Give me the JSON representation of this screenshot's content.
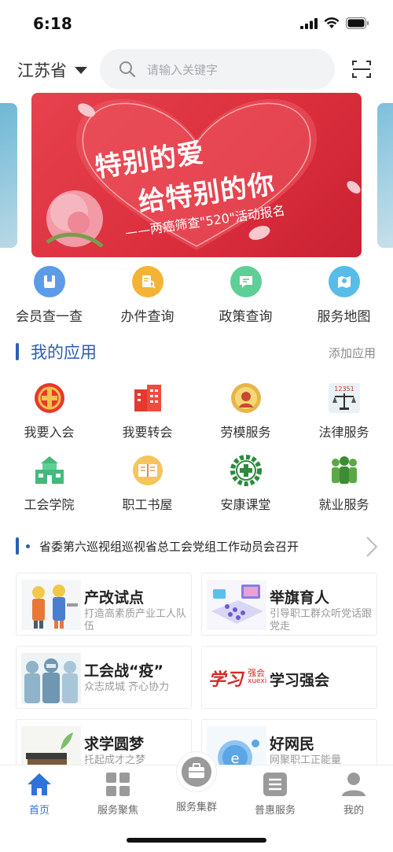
{
  "status_bar": {
    "time": "6:18"
  },
  "header": {
    "province": "江苏省",
    "search_placeholder": "请输入关键字"
  },
  "banner": {
    "line1": "特别的爱",
    "line2": "给特别的你",
    "line3": "——两癌筛查\"520\"活动报名"
  },
  "quick_services": [
    {
      "label": "会员查一查",
      "icon": "member-card-icon",
      "color": "#4a90e2"
    },
    {
      "label": "办件查询",
      "icon": "document-search-icon",
      "color": "#f5a623"
    },
    {
      "label": "政策查询",
      "icon": "policy-chat-icon",
      "color": "#4cc38a"
    },
    {
      "label": "服务地图",
      "icon": "map-icon",
      "color": "#4ab3e6"
    }
  ],
  "my_apps": {
    "title": "我的应用",
    "add_label": "添加应用",
    "items": [
      {
        "label": "我要入会",
        "icon": "union-emblem-icon"
      },
      {
        "label": "我要转会",
        "icon": "building-icon"
      },
      {
        "label": "劳模服务",
        "icon": "model-worker-medal-icon"
      },
      {
        "label": "法律服务",
        "icon": "legal-scale-icon",
        "badge": "12351"
      },
      {
        "label": "工会学院",
        "icon": "school-icon"
      },
      {
        "label": "职工书屋",
        "icon": "book-icon"
      },
      {
        "label": "安康课堂",
        "icon": "health-cross-gear-icon"
      },
      {
        "label": "就业服务",
        "icon": "people-group-icon"
      }
    ]
  },
  "news_ticker": {
    "text": "省委第六巡视组巡视省总工会党组工作动员会召开"
  },
  "cards": [
    {
      "title": "产改试点",
      "subtitle": "打造高素质产业工人队伍",
      "icon": "workers-illustration-icon"
    },
    {
      "title": "举旗育人",
      "subtitle": "引导职工群众听党话跟党走",
      "icon": "classroom-illustration-icon"
    },
    {
      "title": "工会战“疫”",
      "subtitle": "众志成城  齐心协力",
      "icon": "medical-staff-illustration-icon"
    },
    {
      "title": "学习强会",
      "subtitle": "",
      "brand": "学习",
      "brand_tag": "强会",
      "brand_sub": "xuexi",
      "icon": "xuexi-logo-icon"
    },
    {
      "title": "求学圆梦",
      "subtitle": "托起成才之梦",
      "icon": "books-illustration-icon"
    },
    {
      "title": "好网民",
      "subtitle": "网聚职工正能量",
      "icon": "globe-illustration-icon"
    }
  ],
  "tab_bar": [
    {
      "label": "首页",
      "icon": "home-icon",
      "active": true
    },
    {
      "label": "服务聚焦",
      "icon": "grid-icon",
      "active": false
    },
    {
      "label": "服务集群",
      "icon": "briefcase-icon",
      "active": false
    },
    {
      "label": "普惠服务",
      "icon": "list-icon",
      "active": false
    },
    {
      "label": "我的",
      "icon": "user-icon",
      "active": false
    }
  ],
  "colors": {
    "accent": "#2b5fb4",
    "tab_active": "#2f73d8",
    "banner_red": "#dc2f3d"
  }
}
